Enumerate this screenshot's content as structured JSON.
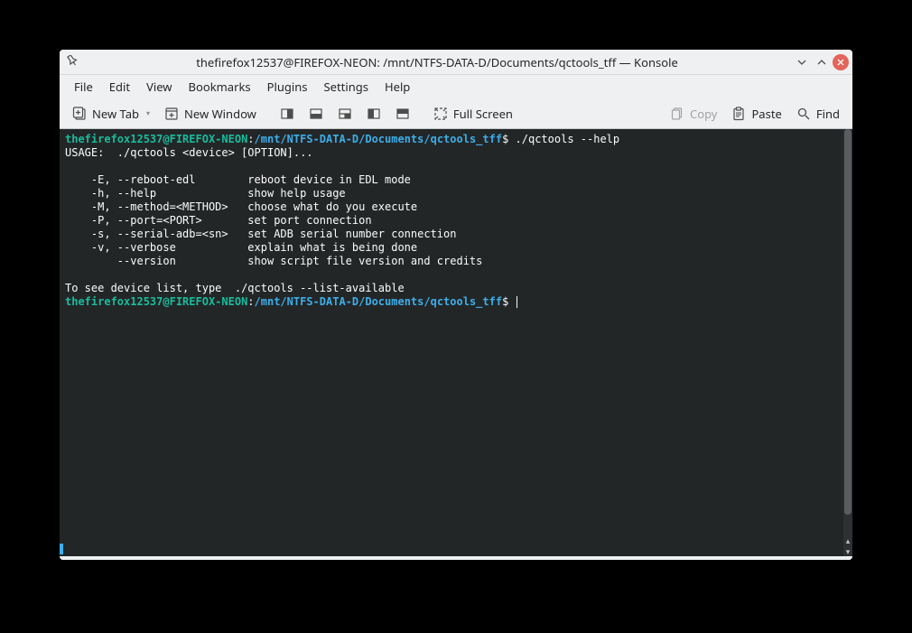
{
  "window": {
    "title": "thefirefox12537@FIREFOX-NEON: /mnt/NTFS-DATA-D/Documents/qctools_tff — Konsole"
  },
  "menubar": {
    "items": [
      "File",
      "Edit",
      "View",
      "Bookmarks",
      "Plugins",
      "Settings",
      "Help"
    ]
  },
  "toolbar": {
    "new_tab": "New Tab",
    "new_window": "New Window",
    "full_screen": "Full Screen",
    "copy": "Copy",
    "paste": "Paste",
    "find": "Find"
  },
  "terminal": {
    "prompt1_user": "thefirefox12537@FIREFOX-NEON",
    "prompt1_sep": ":",
    "prompt1_path": "/mnt/NTFS-DATA-D/Documents/qctools_tff",
    "prompt1_tail": "$ ./qctools --help",
    "body": "USAGE:  ./qctools <device> [OPTION]...\n\n    -E, --reboot-edl        reboot device in EDL mode\n    -h, --help              show help usage\n    -M, --method=<METHOD>   choose what do you execute\n    -P, --port=<PORT>       set port connection\n    -s, --serial-adb=<sn>   set ADB serial number connection\n    -v, --verbose           explain what is being done\n        --version           show script file version and credits\n\nTo see device list, type  ./qctools --list-available",
    "prompt2_user": "thefirefox12537@FIREFOX-NEON",
    "prompt2_sep": ":",
    "prompt2_path": "/mnt/NTFS-DATA-D/Documents/qctools_tff",
    "prompt2_tail": "$ "
  }
}
